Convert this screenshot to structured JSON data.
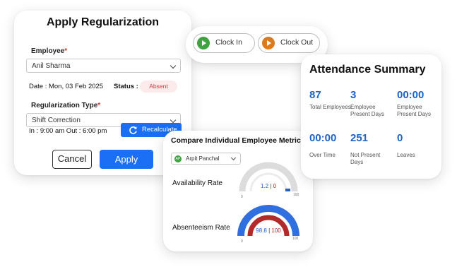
{
  "regularization": {
    "title": "Apply Regularization",
    "employee_label": "Employee",
    "required_mark": "*",
    "employee_value": "Anil Sharma",
    "date_text": "Date : Mon, 03 Feb 2025",
    "status_label": "Status :",
    "status_value": "Absent",
    "type_label": "Regularization Type",
    "type_value": "Shift Correction",
    "in_out_text": "In : 9:00 am Out : 6:00 pm",
    "recalculate_label": "Recalculate",
    "cancel_label": "Cancel",
    "apply_label": "Apply"
  },
  "clock": {
    "in_label": "Clock In",
    "out_label": "Clock Out"
  },
  "summary": {
    "title": "Attendance Summary",
    "stats": [
      {
        "value": "87",
        "label": "Total Employees"
      },
      {
        "value": "3",
        "label": "Employee Present Days"
      },
      {
        "value": "00:00",
        "label": "Employee Present Days"
      },
      {
        "value": "00:00",
        "label": "Over Time"
      },
      {
        "value": "251",
        "label": "Not Present Days"
      },
      {
        "value": "0",
        "label": "Leaves"
      }
    ]
  },
  "compare": {
    "title": "Compare Individual Employee Metric",
    "employee": "Arpit Panchal",
    "employee_initials": "AP",
    "metrics": [
      {
        "label": "Availability Rate",
        "value_a": "1.2",
        "value_b": "0",
        "min": "0",
        "max": "100"
      },
      {
        "label": "Absenteeism Rate",
        "value_a": "98.8",
        "value_b": "100",
        "min": "0",
        "max": "100"
      }
    ]
  },
  "colors": {
    "primary": "#1a6ff5",
    "stat_value": "#1f63c6",
    "absent_bg": "#fdeaea",
    "absent_text": "#c94444",
    "clock_in": "#3fa33f",
    "clock_out": "#dd7a1a",
    "gauge_blue": "#2f6fe0",
    "gauge_red": "#b22a2a",
    "gauge_gray": "#dcdcdc"
  }
}
